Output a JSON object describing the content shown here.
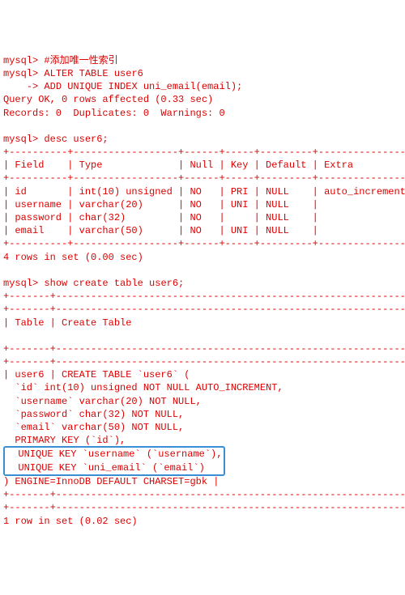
{
  "terminal": {
    "prompt": "mysql>",
    "cont": "    ->",
    "comment": "#添加唯一性索引",
    "stmt1_l1": "ALTER TABLE user6",
    "stmt1_l2": "ADD UNIQUE INDEX uni_email(email);",
    "result1_l1": "Query OK, 0 rows affected (0.33 sec)",
    "result1_l2": "Records: 0  Duplicates: 0  Warnings: 0",
    "stmt2": "desc user6;",
    "tbl_border": "+----------+------------------+------+-----+---------+----------------+",
    "tbl_header": "| Field    | Type             | Null | Key | Default | Extra          |",
    "tbl_row1": "| id       | int(10) unsigned | NO   | PRI | NULL    | auto_increment |",
    "tbl_row2": "| username | varchar(20)      | NO   | UNI | NULL    |                |",
    "tbl_row3": "| password | char(32)         | NO   |     | NULL    |                |",
    "tbl_row4": "| email    | varchar(50)      | NO   | UNI | NULL    |                |",
    "result2": "4 rows in set (0.00 sec)",
    "stmt3": "show create table user6;",
    "ct_border": "+-------+-----------------------------------------------------------------",
    "ct_header": "| Table | Create Table",
    "ct_blank_right": "                                                                        |",
    "ct_row_start": "| user6 | CREATE TABLE `user6` (",
    "ct_col1": "  `id` int(10) unsigned NOT NULL AUTO_INCREMENT,",
    "ct_col2": "  `username` varchar(20) NOT NULL,",
    "ct_col3": "  `password` char(32) NOT NULL,",
    "ct_col4": "  `email` varchar(50) NOT NULL,",
    "ct_pk": "  PRIMARY KEY (`id`),",
    "ct_uk1": "  UNIQUE KEY `username` (`username`),",
    "ct_uk2": "  UNIQUE KEY `uni_email` (`email`)",
    "ct_engine": ") ENGINE=InnoDB DEFAULT CHARSET=gbk |",
    "result3": "1 row in set (0.02 sec)",
    "watermark": ""
  }
}
